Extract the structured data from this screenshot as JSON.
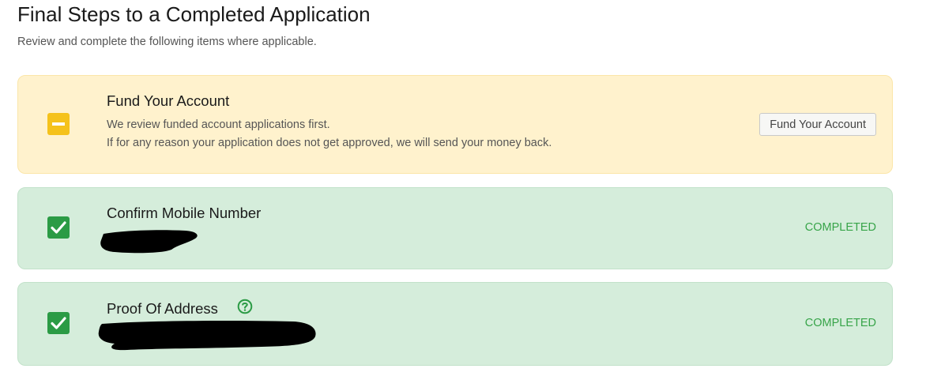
{
  "page": {
    "title": "Final Steps to a Completed Application",
    "subtitle": "Review and complete the following items where applicable."
  },
  "steps": [
    {
      "title": "Fund Your Account",
      "status": "pending",
      "description_lines": [
        "We review funded account applications first.",
        "If for any reason your application does not get approved, we will send your money back."
      ],
      "action_label": "Fund Your Account",
      "icon": "minus-square-icon"
    },
    {
      "title": "Confirm Mobile Number",
      "status": "completed",
      "status_label": "COMPLETED",
      "icon": "check-square-icon",
      "detail": "redacted"
    },
    {
      "title": "Proof Of Address",
      "status": "completed",
      "status_label": "COMPLETED",
      "icon": "check-square-icon",
      "help_icon": "question-circle-icon",
      "detail": "redacted"
    }
  ],
  "colors": {
    "pending_bg": "#fff2cd",
    "pending_icon": "#f5c21b",
    "completed_bg": "#d5eddb",
    "completed_icon": "#2b9b45",
    "completed_text": "#37a449"
  }
}
